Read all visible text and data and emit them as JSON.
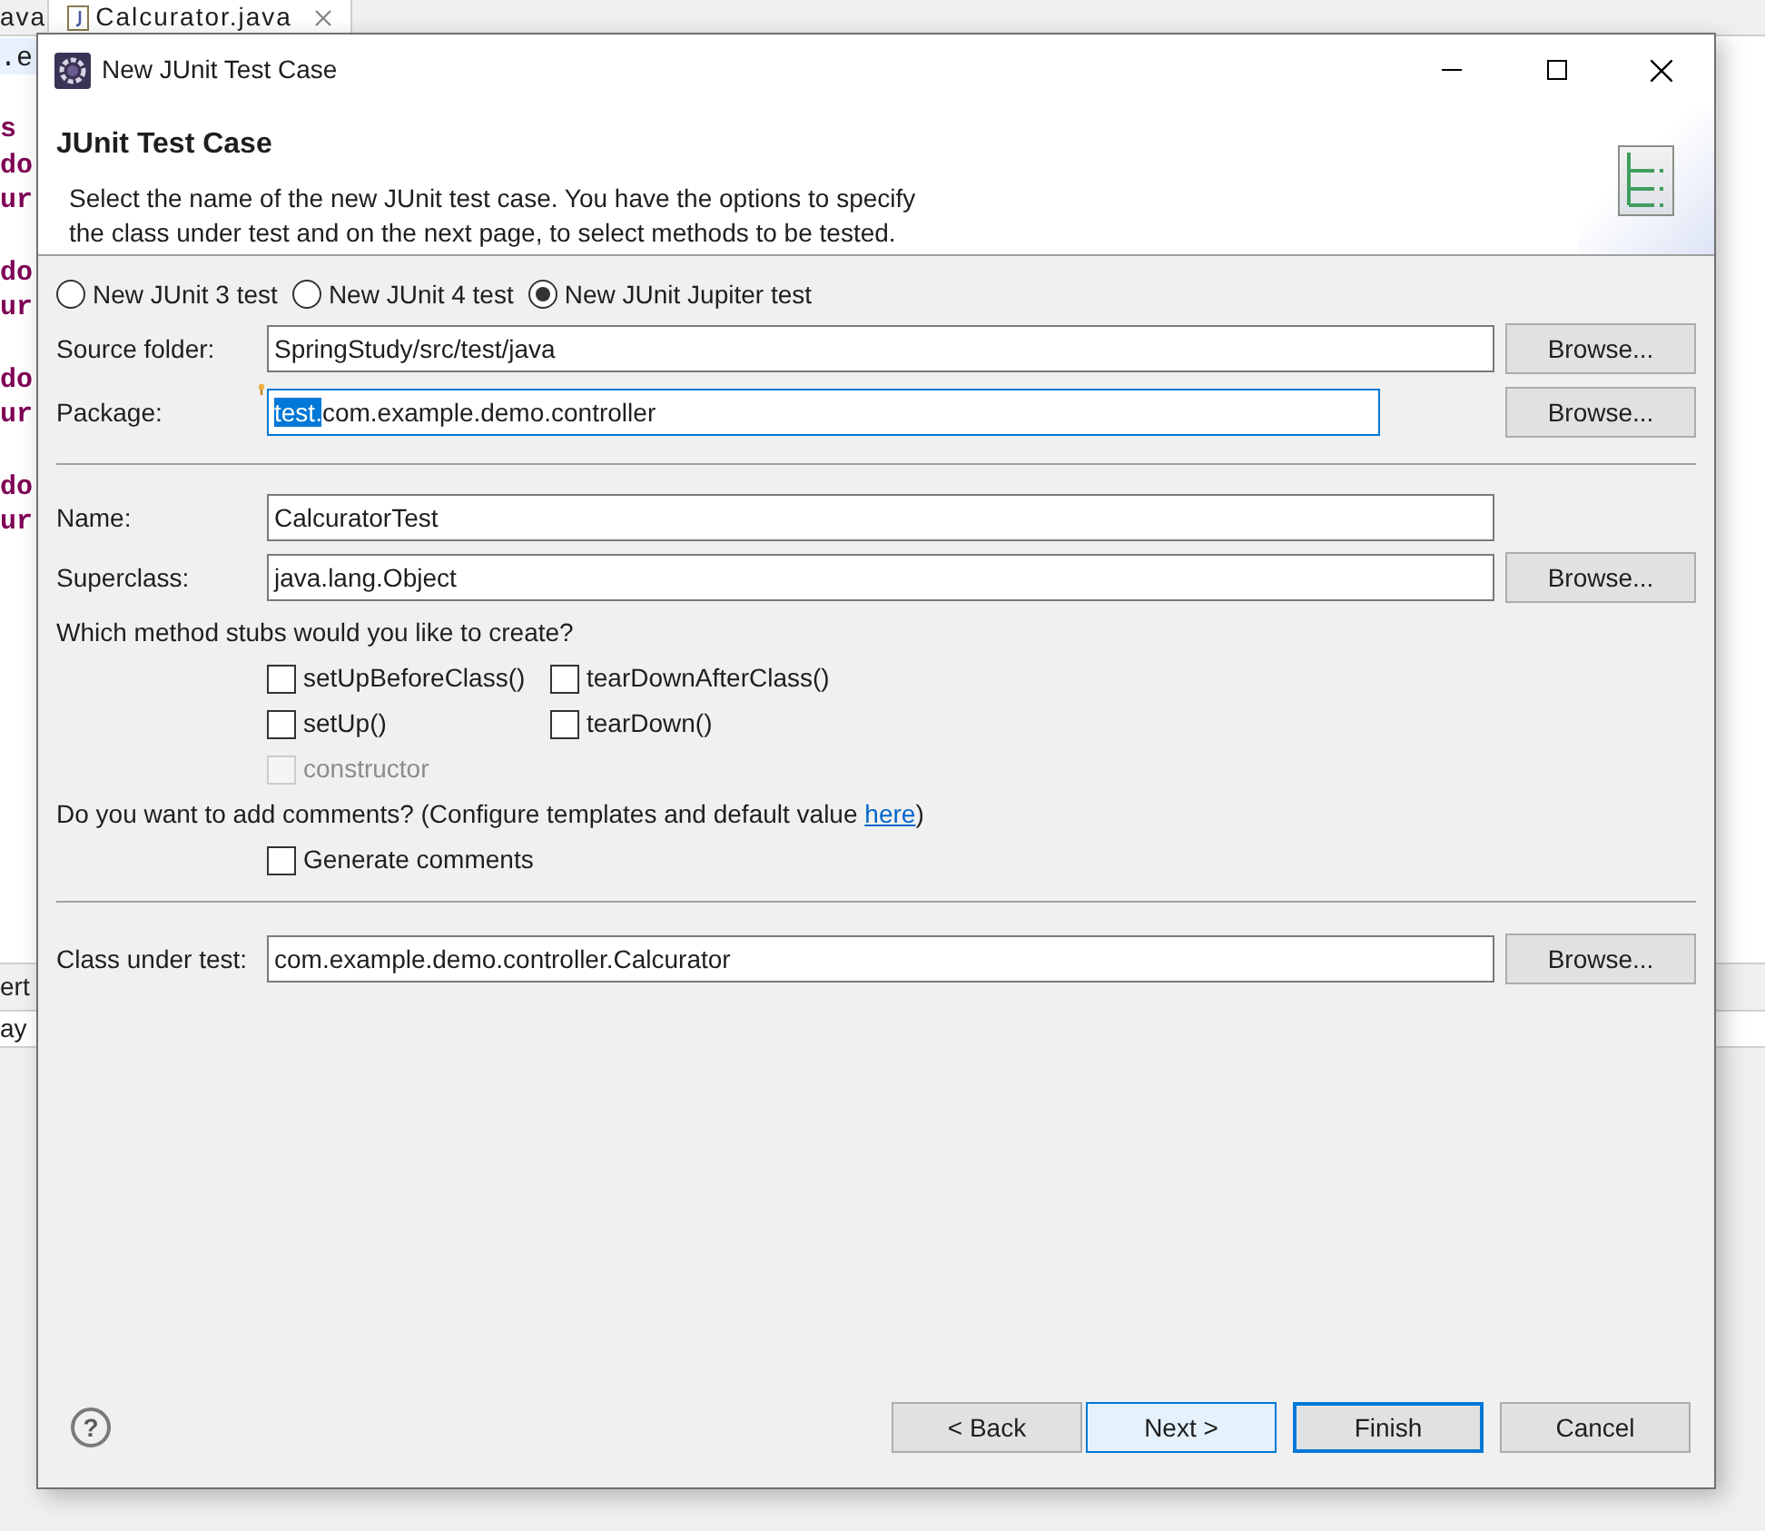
{
  "editor": {
    "tabs": [
      {
        "label": "ava",
        "selected": false
      },
      {
        "label": "Calcurator.java",
        "selected": true
      }
    ],
    "current_line": ".e",
    "code_blocks": [
      [
        "s",
        "do",
        "ur"
      ],
      [
        "do",
        "ur"
      ],
      [
        "do",
        "ur"
      ],
      [
        "do",
        "ur"
      ]
    ],
    "lower_tab": "ert",
    "lower_line": "ay"
  },
  "dialog": {
    "title": "New JUnit Test Case",
    "heading": "JUnit Test Case",
    "description": [
      "Select the name of the new JUnit test case. You have the options to specify",
      "the class under test and on the next page, to select methods to be tested."
    ],
    "radios": [
      {
        "label": "New JUnit 3 test",
        "selected": false
      },
      {
        "label": "New JUnit 4 test",
        "selected": false
      },
      {
        "label": "New JUnit Jupiter test",
        "selected": true
      }
    ],
    "source_folder": {
      "label": "Source folder:",
      "value": "SpringStudy/src/test/java",
      "button": "Browse..."
    },
    "package": {
      "label": "Package:",
      "value_selected": "test.",
      "value_rest": "com.example.demo.controller",
      "focused": true,
      "button": "Browse..."
    },
    "name": {
      "label": "Name:",
      "value": "CalcuratorTest"
    },
    "superclass": {
      "label": "Superclass:",
      "value": "java.lang.Object",
      "button": "Browse..."
    },
    "stubs_question": "Which method stubs would you like to create?",
    "stubs": [
      {
        "label": "setUpBeforeClass()",
        "checked": false,
        "disabled": false
      },
      {
        "label": "tearDownAfterClass()",
        "checked": false,
        "disabled": false
      },
      {
        "label": "setUp()",
        "checked": false,
        "disabled": false
      },
      {
        "label": "tearDown()",
        "checked": false,
        "disabled": false
      },
      {
        "label": "constructor",
        "checked": false,
        "disabled": true
      }
    ],
    "comments_question": {
      "prefix": "Do you want to add comments? (Configure templates and default value ",
      "link": "here",
      "suffix": ")"
    },
    "generate_comments": {
      "label": "Generate comments",
      "checked": false
    },
    "class_under_test": {
      "label": "Class under test:",
      "value": "com.example.demo.controller.Calcurator",
      "button": "Browse..."
    },
    "help": "?",
    "buttons": [
      {
        "label": "< Back",
        "hovered": false,
        "default": false
      },
      {
        "label": "Next >",
        "hovered": true,
        "default": false
      },
      {
        "label": "Finish",
        "hovered": false,
        "default": true
      },
      {
        "label": "Cancel",
        "hovered": false,
        "default": false
      }
    ]
  }
}
